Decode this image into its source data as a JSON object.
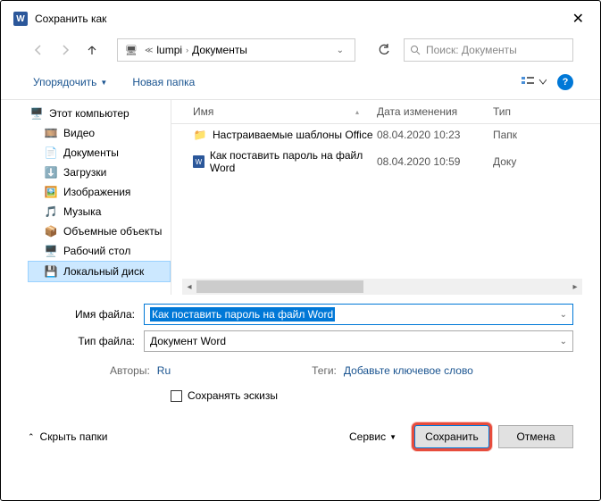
{
  "window": {
    "title": "Сохранить как"
  },
  "path": {
    "root": "lumpi",
    "folder": "Документы"
  },
  "search": {
    "placeholder": "Поиск: Документы"
  },
  "toolbar": {
    "organize": "Упорядочить",
    "newfolder": "Новая папка"
  },
  "columns": {
    "name": "Имя",
    "date": "Дата изменения",
    "type": "Тип"
  },
  "sidebar": {
    "root": "Этот компьютер",
    "items": [
      {
        "label": "Видео"
      },
      {
        "label": "Документы"
      },
      {
        "label": "Загрузки"
      },
      {
        "label": "Изображения"
      },
      {
        "label": "Музыка"
      },
      {
        "label": "Объемные объекты"
      },
      {
        "label": "Рабочий стол"
      },
      {
        "label": "Локальный диск"
      }
    ]
  },
  "files": [
    {
      "name": "Настраиваемые шаблоны Office",
      "date": "08.04.2020 10:23",
      "type": "Папк",
      "kind": "folder"
    },
    {
      "name": "Как поставить пароль на файл Word",
      "date": "08.04.2020 10:59",
      "type": "Доку",
      "kind": "word"
    }
  ],
  "form": {
    "filename_label": "Имя файла:",
    "filename_value": "Как поставить пароль на файл Word",
    "filetype_label": "Тип файла:",
    "filetype_value": "Документ Word",
    "authors_label": "Авторы:",
    "authors_value": "Ru",
    "tags_label": "Теги:",
    "tags_value": "Добавьте ключевое слово",
    "save_thumb": "Сохранять эскизы"
  },
  "footer": {
    "hide": "Скрыть папки",
    "service": "Сервис",
    "save": "Сохранить",
    "cancel": "Отмена"
  }
}
